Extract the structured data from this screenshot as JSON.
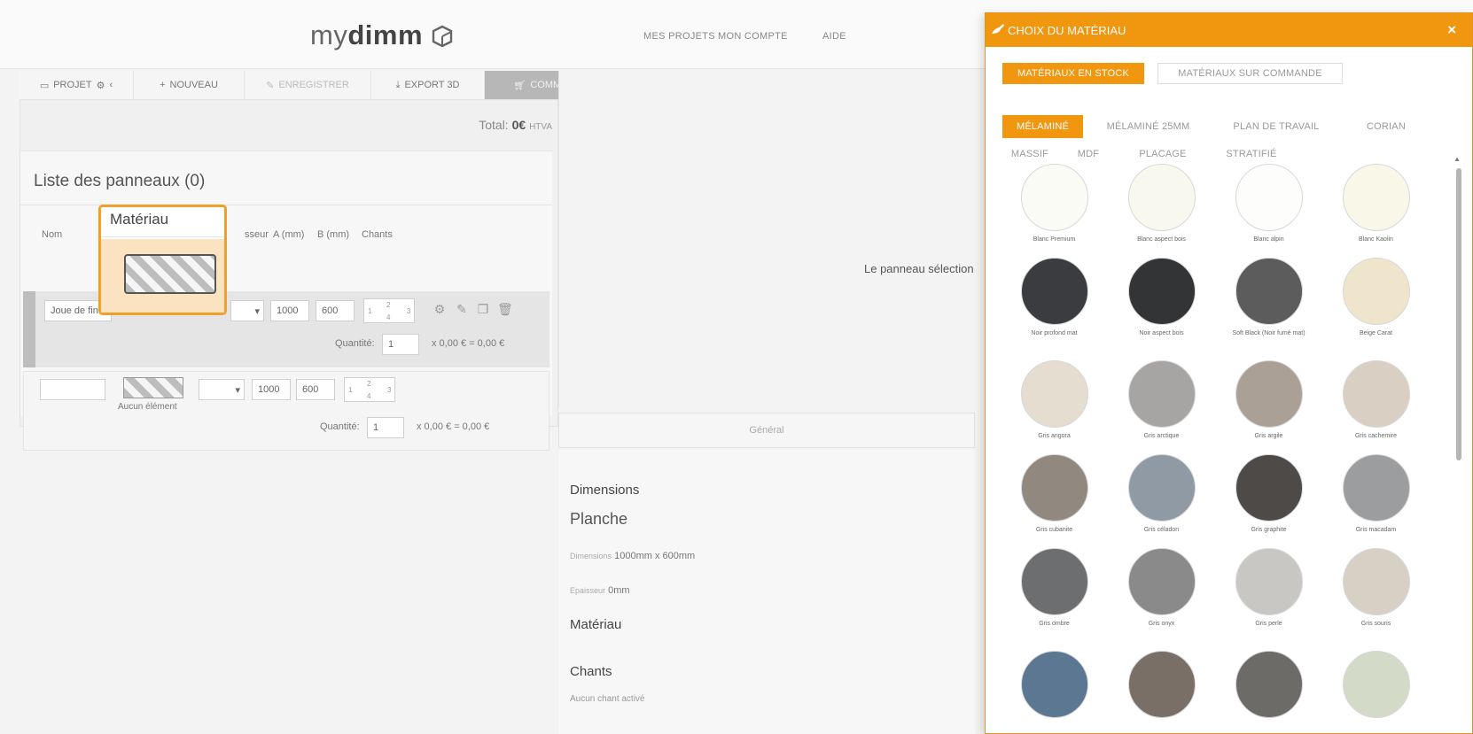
{
  "header": {
    "logo_light": "my",
    "logo_bold": "dimm",
    "nav": [
      "MES PROJETS",
      "MON COMPTE",
      "AIDE"
    ]
  },
  "toolbar": {
    "projet": "PROJET",
    "nouveau": "NOUVEAU",
    "enregistrer": "ENREGISTRER",
    "export": "EXPORT 3D",
    "commander": "COMMANDER"
  },
  "left": {
    "total_label": "Total:",
    "total_value": "0€",
    "total_suffix": "HTVA",
    "list_title": "Liste des panneaux (0)",
    "columns": {
      "nom": "Nom",
      "epaisseur": "sseur",
      "a": "A (mm)",
      "b": "B (mm)",
      "chants": "Chants"
    },
    "row1": {
      "name": "Joue de fin",
      "a": "1000",
      "b": "600",
      "quantite_label": "Quantité:",
      "quantite": "1",
      "price": "x 0,00 € = 0,00 €",
      "chants": [
        "1",
        "2",
        "3",
        "4"
      ]
    },
    "row2": {
      "name": "",
      "a": "1000",
      "b": "600",
      "empty_label": "Aucun élément",
      "quantite_label": "Quantité:",
      "quantite": "1",
      "price": "x 0,00 € = 0,00 €",
      "chants": [
        "1",
        "2",
        "3",
        "4"
      ]
    },
    "highlight_title": "Matériau"
  },
  "middle": {
    "preview_msg": "Le panneau sélection",
    "tab_general": "Général",
    "dimensions_heading": "Dimensions",
    "planche": "Planche",
    "dimensions_label": "Dimensions",
    "dimensions_value": "1000mm x 600mm",
    "epaisseur_label": "Epaisseur",
    "epaisseur_value": "0mm",
    "materiau_heading": "Matériau",
    "chants_heading": "Chants",
    "chants_value": "Aucun chant activé"
  },
  "modal": {
    "title": "CHOIX DU MATÉRIAU",
    "close": "×",
    "stock_tabs": [
      "MATÉRIAUX EN STOCK",
      "MATÉRIAUX SUR COMMANDE"
    ],
    "categories_row1": [
      "MÉLAMINÉ",
      "MÉLAMINÉ 25MM",
      "PLAN DE TRAVAIL",
      "CORIAN"
    ],
    "categories_row2": [
      "MASSIF",
      "MDF",
      "PLACAGE",
      "STRATIFIÉ"
    ],
    "swatches": [
      {
        "name": "Blanc Premium",
        "color": "#fbfbf5"
      },
      {
        "name": "Blanc aspect bois",
        "color": "#f9f8ee"
      },
      {
        "name": "Blanc alpin",
        "color": "#fdfdfb"
      },
      {
        "name": "Blanc Kaolin",
        "color": "#f8f7e8"
      },
      {
        "name": "Noir profond mat",
        "color": "#3a3c3f"
      },
      {
        "name": "Noir aspect bois",
        "color": "#333436"
      },
      {
        "name": "Soft Black (Noir fumé mat)",
        "color": "#5d5c5c"
      },
      {
        "name": "Beige Carat",
        "color": "#efe4cc"
      },
      {
        "name": "Gris angora",
        "color": "#e4ddd0"
      },
      {
        "name": "Gris arctique",
        "color": "#a7a5a4"
      },
      {
        "name": "Gris argile",
        "color": "#aaa095"
      },
      {
        "name": "Gris cachemire",
        "color": "#d9cfc3"
      },
      {
        "name": "Gris cubanite",
        "color": "#918980"
      },
      {
        "name": "Gris céladon",
        "color": "#8f9aa4"
      },
      {
        "name": "Gris graphite",
        "color": "#4d4a48"
      },
      {
        "name": "Gris macadam",
        "color": "#9c9d9e"
      },
      {
        "name": "Gris ombre",
        "color": "#6d6e70"
      },
      {
        "name": "Gris onyx",
        "color": "#8b8a8b"
      },
      {
        "name": "Gris perle",
        "color": "#c8c7c4"
      },
      {
        "name": "Gris souris",
        "color": "#d6d0c5"
      },
      {
        "name": "",
        "color": "#5b7791"
      },
      {
        "name": "",
        "color": "#7a6f67"
      },
      {
        "name": "",
        "color": "#6c6b68"
      },
      {
        "name": "",
        "color": "#d3dac8"
      }
    ]
  }
}
